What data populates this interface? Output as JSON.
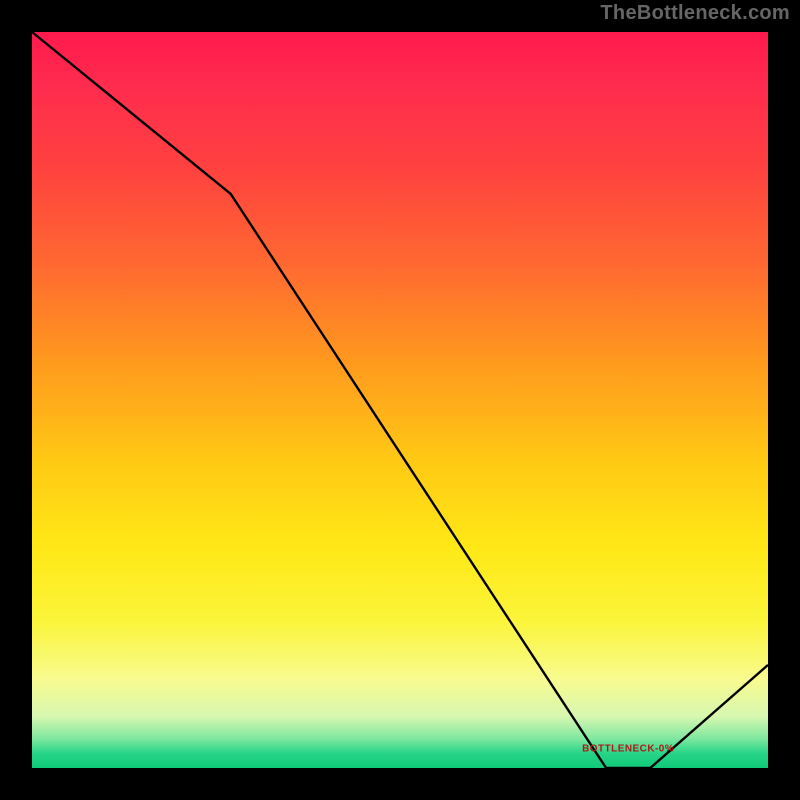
{
  "watermark": "TheBottleneck.com",
  "chart_data": {
    "type": "line",
    "title": "",
    "xlabel": "",
    "ylabel": "",
    "xlim": [
      0,
      100
    ],
    "ylim": [
      0,
      100
    ],
    "x": [
      0,
      27,
      78,
      84,
      100
    ],
    "values": [
      100,
      78,
      0,
      0,
      14
    ],
    "annotations": [
      {
        "x": 81,
        "y": 2,
        "text": "BOTTLENECK-0%"
      }
    ],
    "gradient_stops": [
      {
        "pct": 0,
        "color": "#ff1a4d"
      },
      {
        "pct": 50,
        "color": "#ffc400"
      },
      {
        "pct": 90,
        "color": "#f6fb6a"
      },
      {
        "pct": 100,
        "color": "#0fc979"
      }
    ]
  }
}
